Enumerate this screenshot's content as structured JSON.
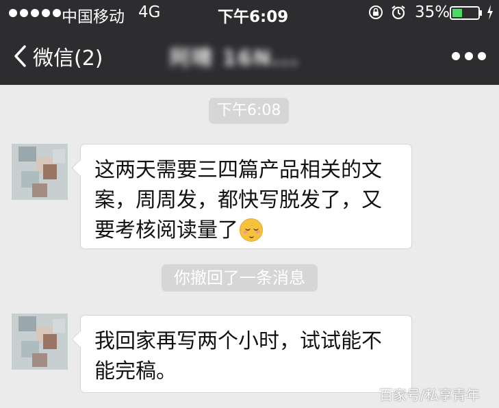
{
  "status_bar": {
    "carrier": "中国移动",
    "network": "4G",
    "time": "下午6:09",
    "battery": "35%"
  },
  "nav": {
    "back_label": "微信(2)",
    "title": "阿晴 16N..."
  },
  "messages": {
    "timestamp": "下午6:08",
    "first_text": "这两天需要三四篇产品相关的文案，周周发，都快写脱发了，又要考核阅读量了",
    "recall_notice": "你撤回了一条消息",
    "second_text": "我回家再写两个小时，试试能不能完稿。"
  },
  "watermark": "百家号/私享青年",
  "colors": {
    "header_bg": "#2d2d30",
    "chat_bg": "#ebebeb",
    "battery_green": "#4cd964"
  }
}
